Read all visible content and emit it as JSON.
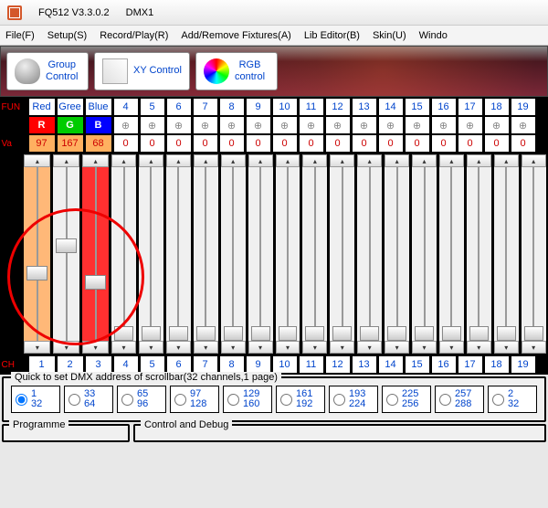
{
  "title": {
    "app": "FQ512 V3.3.0.2",
    "doc": "DMX1"
  },
  "menu": [
    "File(F)",
    "Setup(S)",
    "Record/Play(R)",
    "Add/Remove Fixtures(A)",
    "Lib Editor(B)",
    "Skin(U)",
    "Windo"
  ],
  "toolbar": {
    "group": "Group\nControl",
    "xy": "XY Control",
    "rgb": "RGB\ncontrol"
  },
  "rowlabels": {
    "fun": "FUN",
    "va": "Va",
    "ch": "CH"
  },
  "fun": [
    "Red",
    "Gree",
    "Blue",
    "4",
    "5",
    "6",
    "7",
    "8",
    "9",
    "10",
    "11",
    "12",
    "13",
    "14",
    "15",
    "16",
    "17",
    "18",
    "19"
  ],
  "swatch": [
    "R",
    "G",
    "B"
  ],
  "val": [
    "97",
    "167",
    "68",
    "0",
    "0",
    "0",
    "0",
    "0",
    "0",
    "0",
    "0",
    "0",
    "0",
    "0",
    "0",
    "0",
    "0",
    "0",
    "0"
  ],
  "ch": [
    "1",
    "2",
    "3",
    "4",
    "5",
    "6",
    "7",
    "8",
    "9",
    "10",
    "11",
    "12",
    "13",
    "14",
    "15",
    "16",
    "17",
    "18",
    "19"
  ],
  "quickset": {
    "title": "Quick to set DMX address of scrollbar(32 channels,1 page)",
    "ranges": [
      [
        "1",
        "32"
      ],
      [
        "33",
        "64"
      ],
      [
        "65",
        "96"
      ],
      [
        "97",
        "128"
      ],
      [
        "129",
        "160"
      ],
      [
        "161",
        "192"
      ],
      [
        "193",
        "224"
      ],
      [
        "225",
        "256"
      ],
      [
        "257",
        "288"
      ],
      [
        "2",
        "32"
      ]
    ],
    "selected": 0
  },
  "panels": {
    "prog": "Programme",
    "ctrl": "Control and Debug"
  },
  "sliders": {
    "thumbs": [
      62,
      45,
      68,
      100,
      100,
      100,
      100,
      100,
      100,
      100,
      100,
      100,
      100,
      100,
      100,
      100,
      100,
      100,
      100
    ]
  }
}
